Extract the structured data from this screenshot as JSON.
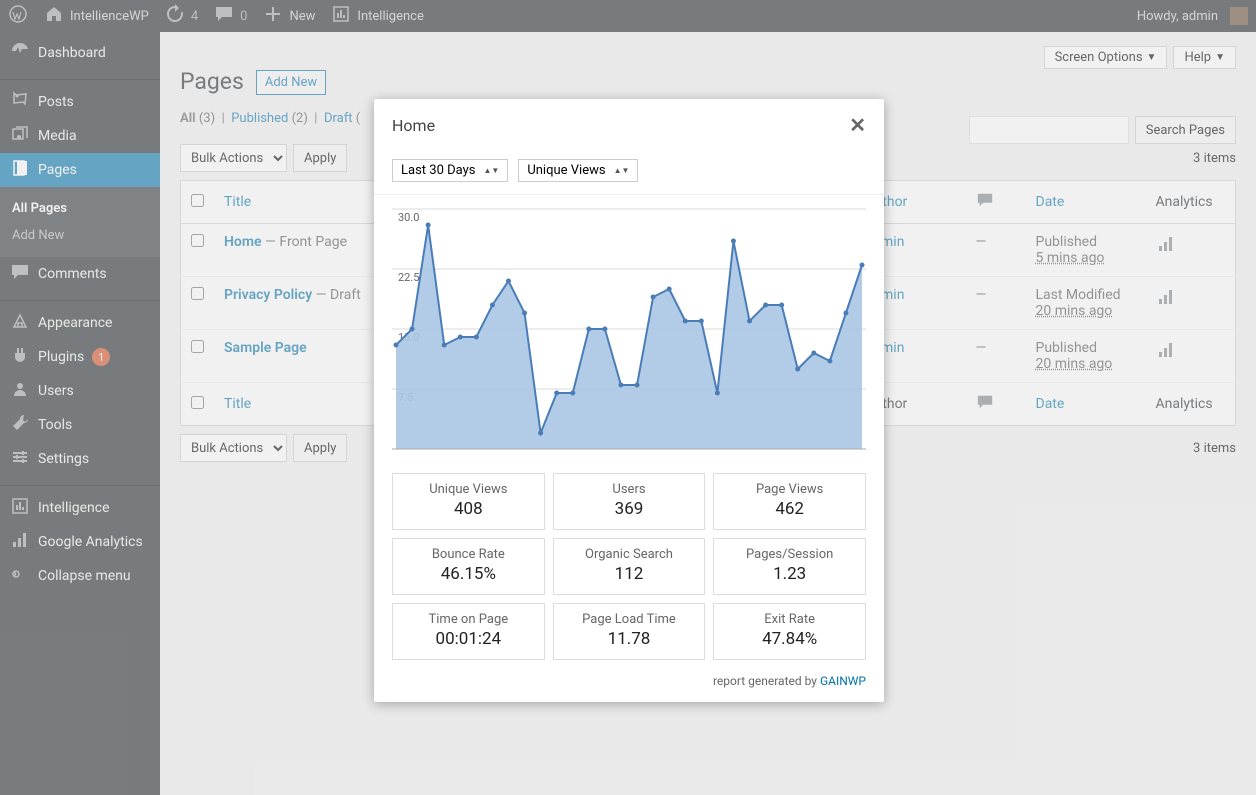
{
  "adminbar": {
    "site": "IntellienceWP",
    "updates": "4",
    "comments": "0",
    "new": "New",
    "intel": "Intelligence",
    "howdy": "Howdy, admin"
  },
  "sidebar": {
    "items": [
      {
        "label": "Dashboard"
      },
      {
        "label": "Posts"
      },
      {
        "label": "Media"
      },
      {
        "label": "Pages"
      },
      {
        "label": "Comments"
      },
      {
        "label": "Appearance"
      },
      {
        "label": "Plugins",
        "badge": "1"
      },
      {
        "label": "Users"
      },
      {
        "label": "Tools"
      },
      {
        "label": "Settings"
      },
      {
        "label": "Intelligence"
      },
      {
        "label": "Google Analytics"
      },
      {
        "label": "Collapse menu"
      }
    ],
    "submenu": {
      "all": "All Pages",
      "add": "Add New"
    }
  },
  "page": {
    "screen_options": "Screen Options",
    "help": "Help",
    "heading": "Pages",
    "add_new": "Add New",
    "filters": {
      "all": "All",
      "all_count": "(3)",
      "published": "Published",
      "published_count": "(2)",
      "draft": "Draft",
      "draft_count": "(",
      "sep": "  |  "
    },
    "bulk": "Bulk Actions",
    "apply": "Apply",
    "search": "Search Pages",
    "items_count": "3 items",
    "columns": {
      "title": "Title",
      "author": "Author",
      "date": "Date",
      "analytics": "Analytics"
    },
    "rows": [
      {
        "title": "Home",
        "state": " — Front Page",
        "author": "admin",
        "comments": "—",
        "date_l": "Published",
        "date_v": "5 mins ago"
      },
      {
        "title": "Privacy Policy",
        "state": " — Draft",
        "author": "admin",
        "comments": "—",
        "date_l": "Last Modified",
        "date_v": "20 mins ago"
      },
      {
        "title": "Sample Page",
        "state": "",
        "author": "admin",
        "comments": "—",
        "date_l": "Published",
        "date_v": "20 mins ago"
      }
    ]
  },
  "modal": {
    "title": "Home",
    "range": "Last 30 Days",
    "metric": "Unique Views",
    "metrics": [
      {
        "label": "Unique Views",
        "value": "408"
      },
      {
        "label": "Users",
        "value": "369"
      },
      {
        "label": "Page Views",
        "value": "462"
      },
      {
        "label": "Bounce Rate",
        "value": "46.15%"
      },
      {
        "label": "Organic Search",
        "value": "112"
      },
      {
        "label": "Pages/Session",
        "value": "1.23"
      },
      {
        "label": "Time on Page",
        "value": "00:01:24"
      },
      {
        "label": "Page Load Time",
        "value": "11.78"
      },
      {
        "label": "Exit Rate",
        "value": "47.84%"
      }
    ],
    "report_generated": "report generated by ",
    "gainwp": "GAINWP"
  },
  "chart_data": {
    "type": "line",
    "ylim": [
      0,
      30
    ],
    "yticks": [
      "30.0",
      "22.5",
      "15.0",
      "7.5"
    ],
    "values": [
      13,
      15,
      28,
      13,
      14,
      14,
      18,
      21,
      17,
      2,
      7,
      7,
      15,
      15,
      8,
      8,
      19,
      20,
      16,
      16,
      7,
      26,
      16,
      18,
      18,
      10,
      12,
      11,
      17,
      23
    ],
    "xlabel": "",
    "ylabel": "",
    "title": ""
  }
}
